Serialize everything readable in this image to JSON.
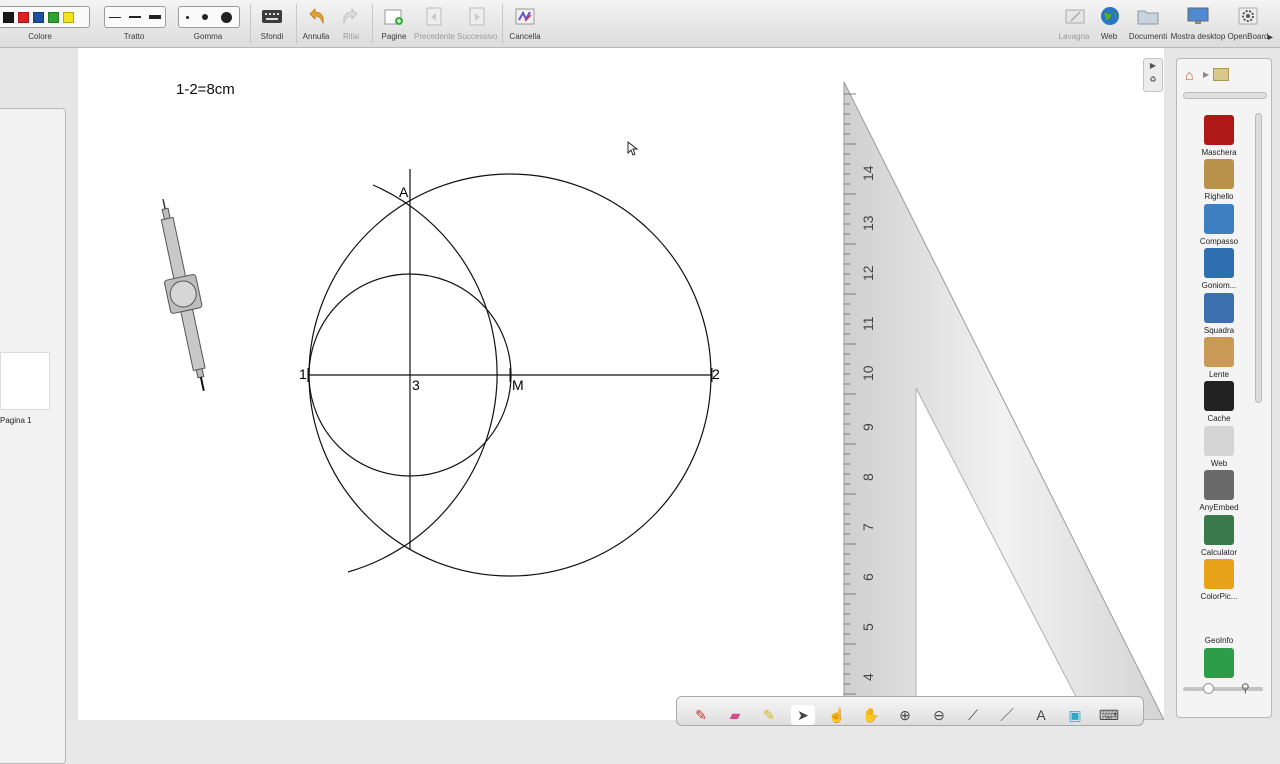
{
  "toolbar": {
    "colore_label": "Colore",
    "tratto_label": "Tratto",
    "gomma_label": "Gomma",
    "sfondi_label": "Sfondi",
    "annulla_label": "Annulla",
    "rifai_label": "Rifai",
    "pagine_label": "Pagine",
    "precedente_label": "Precedente",
    "successivo_label": "Successivo",
    "cancella_label": "Cancella",
    "lavagna_label": "Lavagna",
    "web_label": "Web",
    "documenti_label": "Documenti",
    "mostra_desktop_label": "Mostra desktop",
    "openboard_label": "OpenBoard",
    "colors": [
      "#1a1a1a",
      "#e02020",
      "#1d4fa0",
      "#2ea42e",
      "#f2e21a"
    ]
  },
  "pages": {
    "thumb_label": "Pagina 1"
  },
  "board": {
    "scale_note": "1-2=8cm",
    "point_labels": {
      "p1": "1",
      "p2": "2",
      "p3": "3",
      "pM": "M",
      "pA": "A"
    },
    "ruler_ticks": [
      "14",
      "13",
      "12",
      "11",
      "10",
      "9",
      "8",
      "7",
      "6",
      "5",
      "4"
    ]
  },
  "library": {
    "items": [
      {
        "label": "Maschera",
        "icon": "mask-icon",
        "color": "#b01818"
      },
      {
        "label": "Righello",
        "icon": "ruler-icon",
        "color": "#b8914a"
      },
      {
        "label": "Compasso",
        "icon": "compass-icon",
        "color": "#3d7fc1"
      },
      {
        "label": "Goniom...",
        "icon": "protractor-icon",
        "color": "#2f6fb0"
      },
      {
        "label": "Squadra",
        "icon": "set-square-icon",
        "color": "#3b6fae"
      },
      {
        "label": "Lente",
        "icon": "magnifier-icon",
        "color": "#c89a55"
      },
      {
        "label": "Cache",
        "icon": "cache-icon",
        "color": "#222222"
      },
      {
        "label": "Web",
        "icon": "folder-icon",
        "color": "#d4d4d4"
      },
      {
        "label": "AnyEmbed",
        "icon": "embed-icon",
        "color": "#6a6a6a"
      },
      {
        "label": "Calculator",
        "icon": "calculator-icon",
        "color": "#3a7a4a"
      },
      {
        "label": "ColorPic...",
        "icon": "color-picker-icon",
        "color": "#e8a21a"
      },
      {
        "label": "GeoInfo",
        "icon": "world-map-icon",
        "color": "#f4f4f4"
      },
      {
        "label": "",
        "icon": "map-pin-icon",
        "color": "#2d9d4a"
      }
    ]
  }
}
